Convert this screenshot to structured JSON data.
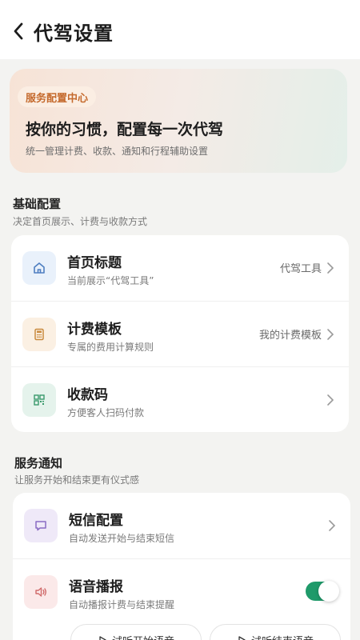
{
  "nav": {
    "title": "代驾设置"
  },
  "hero": {
    "tag": "服务配置中心",
    "title": "按你的习惯，配置每一次代驾",
    "subtitle": "统一管理计费、收款、通知和行程辅助设置"
  },
  "basic": {
    "title": "基础配置",
    "subtitle": "决定首页展示、计费与收款方式",
    "items": [
      {
        "title": "首页标题",
        "subtitle": "当前展示“代驾工具”",
        "value": "代驾工具",
        "icon": "home-icon"
      },
      {
        "title": "计费模板",
        "subtitle": "专属的费用计算规则",
        "value": "我的计费模板",
        "icon": "calculator-icon"
      },
      {
        "title": "收款码",
        "subtitle": "方便客人扫码付款",
        "value": "",
        "icon": "qrcode-icon"
      }
    ]
  },
  "notice": {
    "title": "服务通知",
    "subtitle": "让服务开始和结束更有仪式感",
    "items": [
      {
        "title": "短信配置",
        "subtitle": "自动发送开始与结束短信",
        "icon": "message-icon"
      },
      {
        "title": "语音播报",
        "subtitle": "自动播报计费与结束提醒",
        "icon": "speaker-icon",
        "toggle_on": true
      }
    ],
    "buttons": {
      "start_preview": "试听开始语音",
      "end_preview": "试听结束语音"
    }
  },
  "colors": {
    "accent": "#1f9a6a",
    "tag_text": "#c56a2d"
  }
}
